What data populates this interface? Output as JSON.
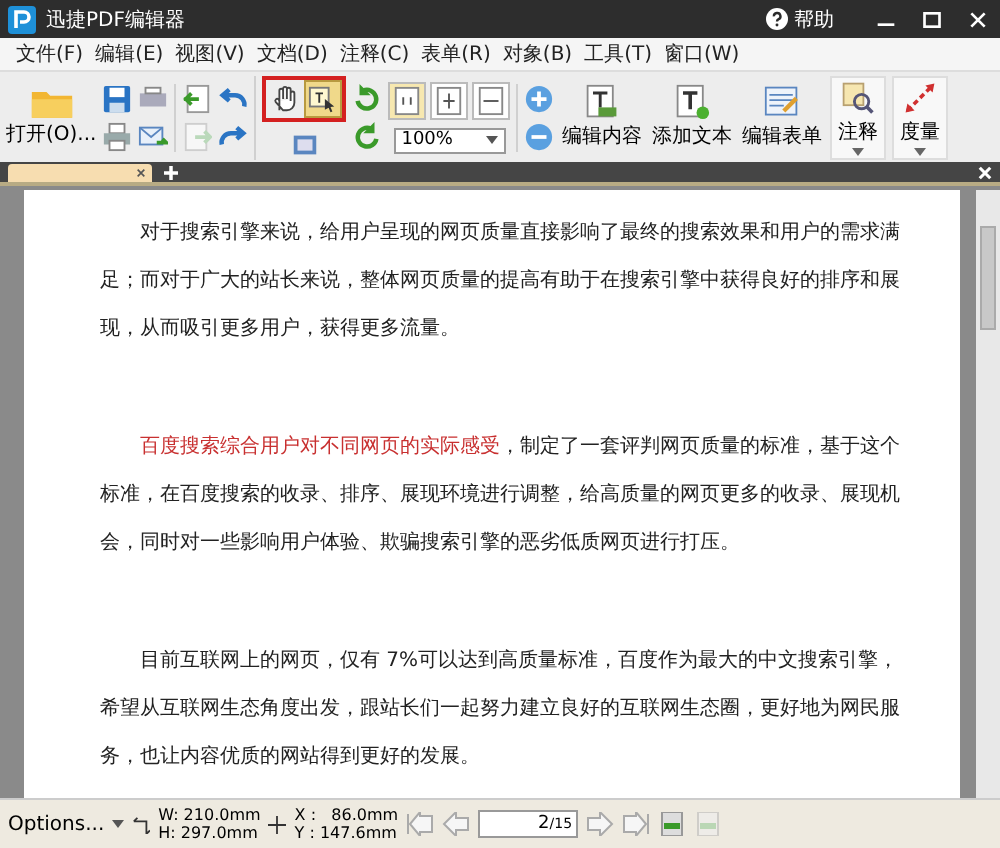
{
  "window": {
    "title": "迅捷PDF编辑器",
    "help": "帮助"
  },
  "menu": [
    "文件(F)",
    "编辑(E)",
    "视图(V)",
    "文档(D)",
    "注释(C)",
    "表单(R)",
    "对象(B)",
    "工具(T)",
    "窗口(W)"
  ],
  "toolbar": {
    "open": "打开(O)...",
    "callout": true,
    "tools": [
      {
        "kind": "hand",
        "selected": false
      },
      {
        "kind": "select",
        "selected": true
      }
    ],
    "zoom": "100%",
    "big_buttons": [
      {
        "kind": "edit-content",
        "label": "编辑内容",
        "dropdown": false
      },
      {
        "kind": "add-text",
        "label": "添加文本",
        "dropdown": false
      },
      {
        "kind": "edit-form",
        "label": "编辑表单",
        "dropdown": false
      },
      {
        "kind": "comment",
        "label": "注释",
        "dropdown": true
      },
      {
        "kind": "measure",
        "label": "度量",
        "dropdown": true
      }
    ]
  },
  "document": {
    "paragraphs": [
      [
        {
          "text": "对于搜索引擎来说，给用户呈现的网页质量直接影响了最终的搜索效果和用户的需求满足；而对于广大的站长来说，整体网页质量的提高有助于在搜索引擎中获得良好的排序和展现，从而吸引更多用户，获得更多流量。",
          "highlight": false
        }
      ],
      [
        {
          "text": "百度搜索综合用户对不同网页的实际感受",
          "highlight": true
        },
        {
          "text": "，制定了一套评判网页质量的标准，基于这个标准，在百度搜索的收录、排序、展现环境进行调整，给高质量的网页更多的收录、展现机会，同时对一些影响用户体验、欺骗搜索引擎的恶劣低质网页进行打压。",
          "highlight": false
        }
      ],
      [
        {
          "text": "目前互联网上的网页，仅有 7%可以达到高质量标准，百度作为最大的中文搜索引擎，希望从互联网生态角度出发，跟站长们一起努力建立良好的互联网生态圈，更好地为网民服务，也让内容优质的网站得到更好的发展。",
          "highlight": false
        }
      ]
    ]
  },
  "status_bar": {
    "options": "Options...",
    "width": "W: 210.0mm",
    "height": "H: 297.0mm",
    "x": "X :   86.0mm",
    "y": "Y : 147.6mm",
    "page": "2",
    "total": "/15"
  }
}
